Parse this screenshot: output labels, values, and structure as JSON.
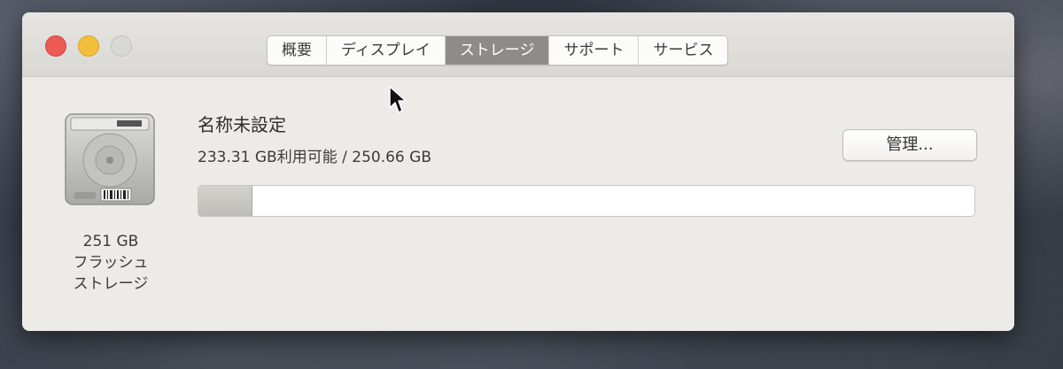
{
  "tabs": [
    {
      "label": "概要",
      "active": false
    },
    {
      "label": "ディスプレイ",
      "active": false
    },
    {
      "label": "ストレージ",
      "active": true
    },
    {
      "label": "サポート",
      "active": false
    },
    {
      "label": "サービス",
      "active": false
    }
  ],
  "drive": {
    "capacity": "251 GB",
    "type_line1": "フラッシュ",
    "type_line2": "ストレージ",
    "icon": "hard-drive-icon"
  },
  "volume": {
    "name": "名称未設定",
    "usage_text": "233.31 GB利用可能 / 250.66 GB",
    "used_fraction": 0.069
  },
  "manage_button": {
    "label": "管理..."
  },
  "colors": {
    "close": "#ec5b54",
    "minimize": "#f2bf3b",
    "zoom": "#d9d8d5",
    "active_tab": "#8d8c89"
  }
}
